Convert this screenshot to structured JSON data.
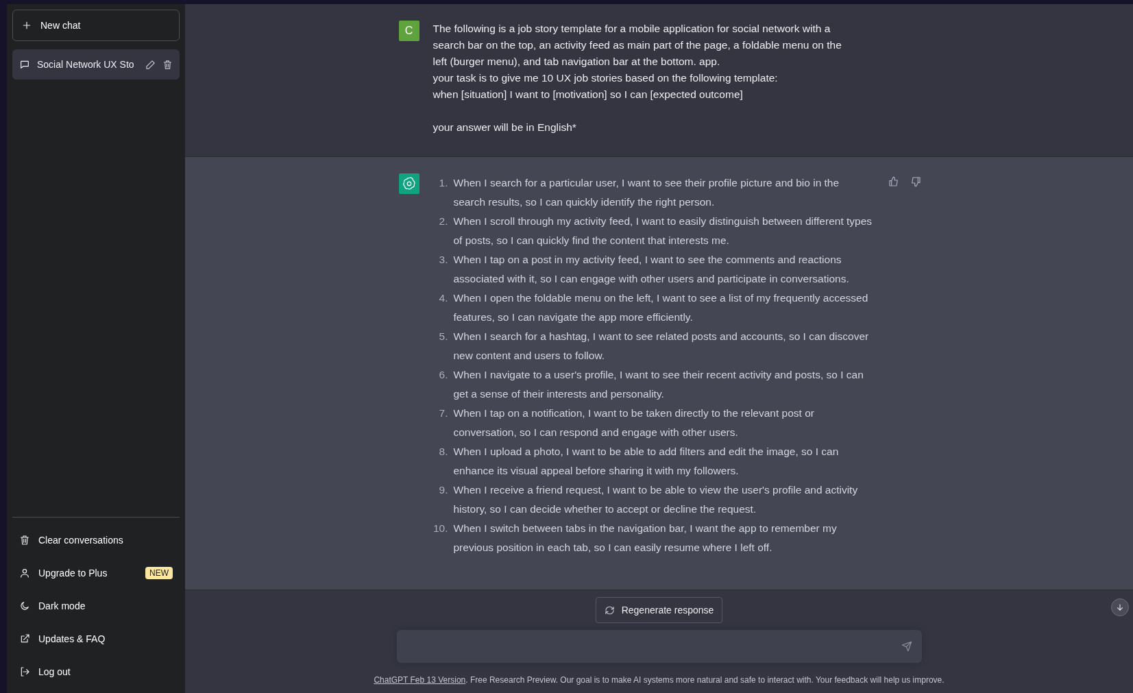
{
  "sidebar": {
    "new_chat": {
      "label": "New chat"
    },
    "conversations": [
      {
        "title": "Social Network UX Sto",
        "selected": true
      }
    ],
    "menu": [
      {
        "kind": "trash",
        "label": "Clear conversations"
      },
      {
        "kind": "user",
        "label": "Upgrade to Plus",
        "badge": "NEW"
      },
      {
        "kind": "moon",
        "label": "Dark mode"
      },
      {
        "kind": "external",
        "label": "Updates & FAQ"
      },
      {
        "kind": "logout",
        "label": "Log out"
      }
    ]
  },
  "messages": [
    {
      "kind": "user",
      "avatar": "C",
      "text": "The following is a job story template for a mobile application for social network with a search bar on the top, an activity feed as main part of the page, a foldable menu on the left (burger menu), and tab navigation bar at the bottom. app.\nyour task is to give me 10 UX job stories based on the following template:\nwhen [situation] I want to [motivation] so I can [expected outcome]\n\nyour answer will be in English*"
    },
    {
      "kind": "assistant",
      "items": [
        {
          "number": "1.",
          "text": "When I search for a particular user, I want to see their profile picture and bio in the search results, so I can quickly identify the right person."
        },
        {
          "number": "2.",
          "text": "When I scroll through my activity feed, I want to easily distinguish between different types of posts, so I can quickly find the content that interests me."
        },
        {
          "number": "3.",
          "text": "When I tap on a post in my activity feed, I want to see the comments and reactions associated with it, so I can engage with other users and participate in conversations."
        },
        {
          "number": "4.",
          "text": "When I open the foldable menu on the left, I want to see a list of my frequently accessed features, so I can navigate the app more efficiently."
        },
        {
          "number": "5.",
          "text": "When I search for a hashtag, I want to see related posts and accounts, so I can discover new content and users to follow."
        },
        {
          "number": "6.",
          "text": "When I navigate to a user's profile, I want to see their recent activity and posts, so I can get a sense of their interests and personality."
        },
        {
          "number": "7.",
          "text": "When I tap on a notification, I want to be taken directly to the relevant post or conversation, so I can respond and engage with other users."
        },
        {
          "number": "8.",
          "text": "When I upload a photo, I want to be able to add filters and edit the image, so I can enhance its visual appeal before sharing it with my followers."
        },
        {
          "number": "9.",
          "text": "When I receive a friend request, I want to be able to view the user's profile and activity history, so I can decide whether to accept or decline the request."
        },
        {
          "number": "10.",
          "text": "When I switch between tabs in the navigation bar, I want the app to remember my previous position in each tab, so I can easily resume where I left off."
        }
      ]
    }
  ],
  "regenerate": {
    "label": "Regenerate response"
  },
  "footer": {
    "link": "ChatGPT Feb 13 Version",
    "text": ". Free Research Preview. Our goal is to make AI systems more natural and safe to interact with. Your feedback will help us improve."
  }
}
